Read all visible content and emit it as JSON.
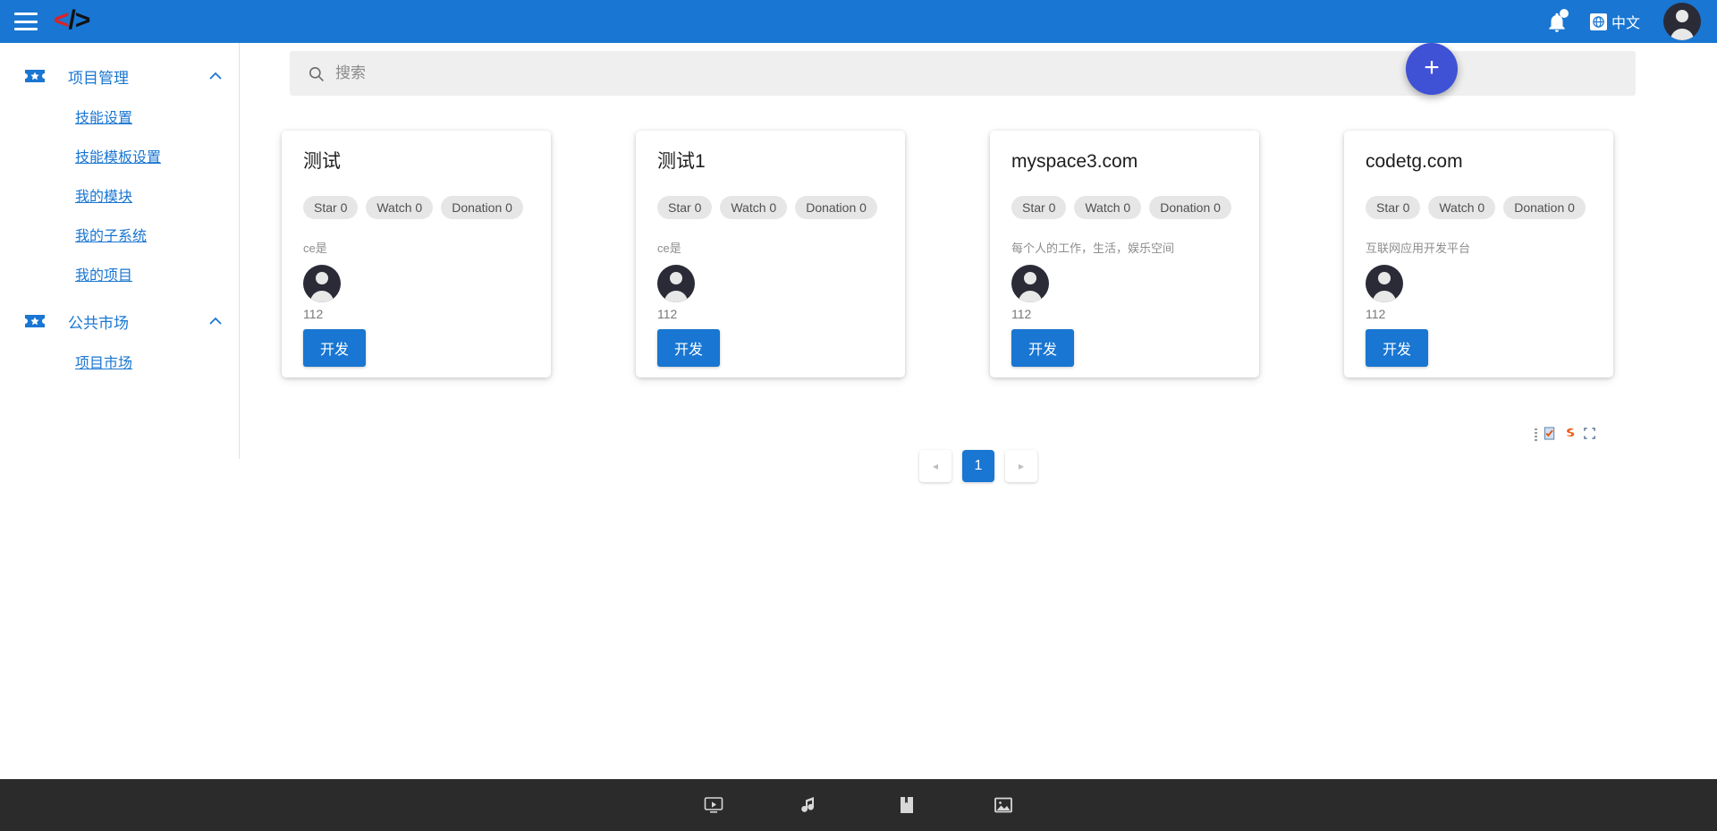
{
  "appbar": {
    "menu_icon": "hamburger-icon",
    "logo_text": {
      "lt": "<",
      "slash": "/",
      "gt": ">"
    },
    "bell_icon": "bell-icon",
    "language_label": "中文",
    "globe_icon": "globe-icon",
    "avatar_icon": "user-avatar-icon"
  },
  "sidebar": {
    "groups": [
      {
        "label": "项目管理",
        "icon": "ticket-star-icon",
        "expanded": true,
        "chevron": "︿",
        "children": [
          {
            "label": "技能设置"
          },
          {
            "label": "技能模板设置"
          },
          {
            "label": "我的模块"
          },
          {
            "label": "我的子系统"
          },
          {
            "label": "我的项目"
          }
        ]
      },
      {
        "label": "公共市场",
        "icon": "ticket-star-icon",
        "expanded": true,
        "chevron": "︿",
        "children": [
          {
            "label": "项目市场"
          }
        ]
      }
    ]
  },
  "search": {
    "placeholder": "搜索",
    "value": "",
    "icon": "search-icon"
  },
  "fab": {
    "label": "+",
    "icon": "plus-icon",
    "color": "#3f51d5"
  },
  "cards": [
    {
      "title": "测试",
      "pills": [
        "Star 0",
        "Watch 0",
        "Donation 0"
      ],
      "description": "ce是",
      "avatar_icon": "user-avatar-icon",
      "username": "112",
      "action_label": "开发"
    },
    {
      "title": "测试1",
      "pills": [
        "Star 0",
        "Watch 0",
        "Donation 0"
      ],
      "description": "ce是",
      "avatar_icon": "user-avatar-icon",
      "username": "112",
      "action_label": "开发"
    },
    {
      "title": "myspace3.com",
      "pills": [
        "Star 0",
        "Watch 0",
        "Donation 0"
      ],
      "description": "每个人的工作，生活，娱乐空间",
      "avatar_icon": "user-avatar-icon",
      "username": "112",
      "action_label": "开发"
    },
    {
      "title": "codetg.com",
      "pills": [
        "Star 0",
        "Watch 0",
        "Donation 0"
      ],
      "description": "互联网应用开发平台",
      "avatar_icon": "user-avatar-icon",
      "username": "112",
      "action_label": "开发"
    }
  ],
  "pagination": {
    "prev_label": "◂",
    "next_label": "▸",
    "pages": [
      "1"
    ],
    "active_page": "1"
  },
  "extension_toolbar": {
    "items": [
      "note-check-icon",
      "sogou-s-icon",
      "screen-capture-icon"
    ]
  },
  "dock": {
    "items": [
      {
        "icon": "video-player-icon"
      },
      {
        "icon": "music-note-icon"
      },
      {
        "icon": "book-icon"
      },
      {
        "icon": "image-icon"
      }
    ]
  },
  "colors": {
    "primary": "#1976d2",
    "fab": "#3f51d5",
    "dock_bg": "#2b2b2b",
    "avatar_bg": "#2b2b38",
    "pill_bg": "#e6e6e6",
    "search_bg": "#efefef"
  }
}
